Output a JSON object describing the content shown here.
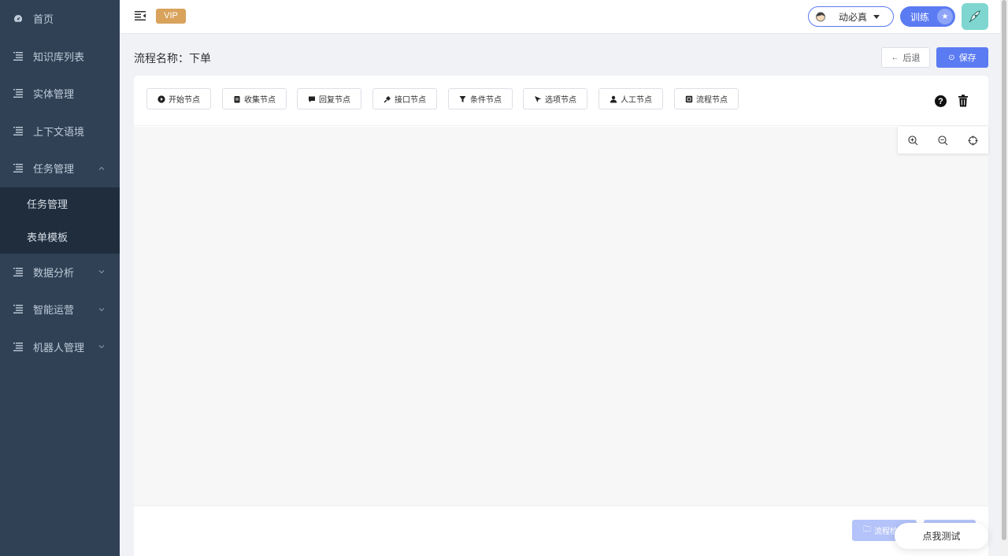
{
  "sidebar": {
    "items": [
      {
        "label": "首页",
        "icon": "dashboard-icon"
      },
      {
        "label": "知识库列表",
        "icon": "list-icon"
      },
      {
        "label": "实体管理",
        "icon": "list-icon"
      },
      {
        "label": "上下文语境",
        "icon": "list-icon"
      },
      {
        "label": "任务管理",
        "icon": "list-icon",
        "expanded": true
      },
      {
        "label": "数据分析",
        "icon": "list-icon"
      },
      {
        "label": "智能运营",
        "icon": "list-icon"
      },
      {
        "label": "机器人管理",
        "icon": "list-icon"
      }
    ],
    "sub_items": [
      "任务管理",
      "表单模板"
    ]
  },
  "header": {
    "vip_label": "VIP",
    "user_name": "动必真",
    "train_label": "训练"
  },
  "flow": {
    "title": "流程名称：下单",
    "back_label": "后退",
    "save_label": "保存"
  },
  "toolbar": {
    "nodes": [
      "开始节点",
      "收集节点",
      "回复节点",
      "接口节点",
      "条件节点",
      "选项节点",
      "人工节点",
      "流程节点"
    ],
    "help_glyph": "?"
  },
  "bottom": {
    "check_label": "流程检"
  },
  "test_button": "点我测试",
  "colors": {
    "sidebar_bg": "#304156",
    "submenu_bg": "#1f2d3d",
    "accent": "#5b7bf2",
    "vip": "#d9a35c"
  }
}
